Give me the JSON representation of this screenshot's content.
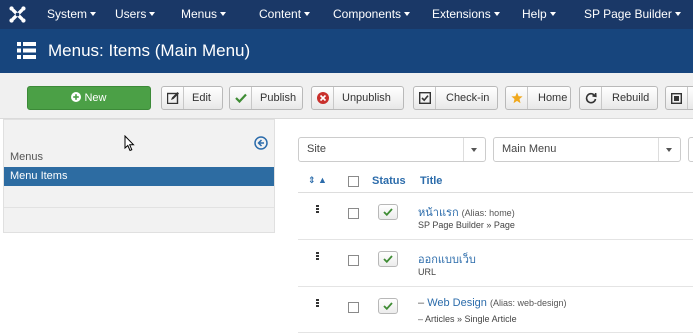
{
  "navbar": {
    "items": [
      {
        "label": "System"
      },
      {
        "label": "Users"
      },
      {
        "label": "Menus"
      },
      {
        "label": "Content"
      },
      {
        "label": "Components"
      },
      {
        "label": "Extensions"
      },
      {
        "label": "Help"
      },
      {
        "label": "SP Page Builder"
      }
    ]
  },
  "page": {
    "title": "Menus: Items (Main Menu)"
  },
  "toolbar": {
    "new_label": "New",
    "edit_label": "Edit",
    "publish_label": "Publish",
    "unpublish_label": "Unpublish",
    "checkin_label": "Check-in",
    "home_label": "Home",
    "rebuild_label": "Rebuild"
  },
  "sidebar": {
    "heading": "Menus",
    "active_item": "Menu Items"
  },
  "filters": {
    "site": "Site",
    "menu": "Main Menu"
  },
  "table": {
    "col_status": "Status",
    "col_title": "Title",
    "rows": [
      {
        "title": "หน้าแรก",
        "alias": "(Alias: home)",
        "sub": "SP Page Builder » Page",
        "prefix": ""
      },
      {
        "title": "ออกแบบเว็บ",
        "alias": "",
        "sub": "URL",
        "prefix": ""
      },
      {
        "title": "Web Design",
        "alias": "(Alias: web-design)",
        "sub": "Articles » Single Article",
        "prefix": "–"
      }
    ]
  },
  "colors": {
    "navbar_bg": "#1a3867",
    "titlebar_bg": "#17457d",
    "new_button": "#4ba046",
    "active_sidebar": "#2d6ca2",
    "link": "#2c6cab"
  },
  "icons": {
    "logo": "joomla-logo-icon",
    "title": "list-menu-icon",
    "new": "plus-circle-icon",
    "edit": "edit-icon",
    "publish": "check-icon",
    "unpublish": "x-circle-icon",
    "checkin": "checkbox-icon",
    "home": "star-icon",
    "rebuild": "refresh-icon"
  }
}
